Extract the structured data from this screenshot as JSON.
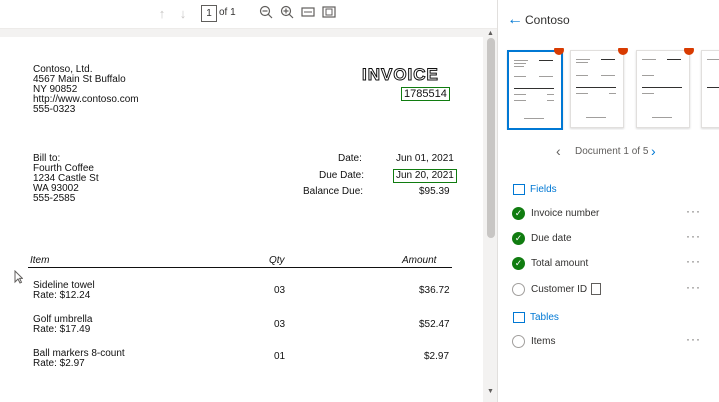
{
  "toolbar": {
    "page_current": "1",
    "page_of": "of 1"
  },
  "invoice": {
    "seller": [
      "Contoso, Ltd.",
      "4567 Main St Buffalo",
      "NY 90852",
      "http://www.contoso.com",
      "555-0323"
    ],
    "title": "INVOICE",
    "number": "1785514",
    "bill_to": [
      "Bill to:",
      "Fourth Coffee",
      "1234 Castle St",
      "WA 93002",
      "555-2585"
    ],
    "date_label": "Date:",
    "date_value": "Jun 01, 2021",
    "due_label": "Due Date:",
    "due_value": "Jun 20, 2021",
    "balance_label": "Balance Due:",
    "balance_value": "$95.39",
    "col_item": "Item",
    "col_qty": "Qty",
    "col_amount": "Amount",
    "items": [
      {
        "name": "Sideline towel",
        "rate": "Rate: $12.24",
        "qty": "03",
        "amount": "$36.72"
      },
      {
        "name": "Golf umbrella",
        "rate": "Rate: $17.49",
        "qty": "03",
        "amount": "$52.47"
      },
      {
        "name": "Ball markers 8-count",
        "rate": "Rate: $2.97",
        "qty": "01",
        "amount": "$2.97"
      }
    ]
  },
  "panel": {
    "title": "Contoso",
    "pager": "Document 1 of 5",
    "fields_header": "Fields",
    "fields": [
      {
        "label": "Invoice number",
        "done": true
      },
      {
        "label": "Due date",
        "done": true
      },
      {
        "label": "Total amount",
        "done": true
      },
      {
        "label": "Customer ID",
        "done": false
      }
    ],
    "tables_header": "Tables",
    "tables": [
      {
        "label": "Items",
        "done": false
      }
    ]
  },
  "colors": {
    "accent": "#0078d4",
    "success": "#107c10",
    "alert": "#d83b01"
  }
}
